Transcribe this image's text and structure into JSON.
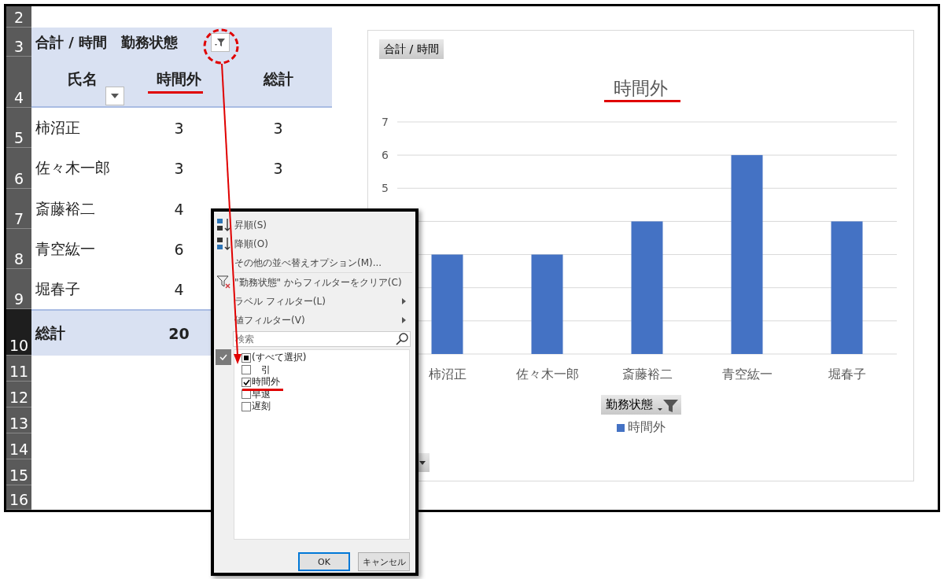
{
  "row_headers": [
    {
      "label": "2",
      "selected": false
    },
    {
      "label": "3",
      "selected": false
    },
    {
      "label": "4",
      "selected": false
    },
    {
      "label": "5",
      "selected": false
    },
    {
      "label": "6",
      "selected": false
    },
    {
      "label": "7",
      "selected": false
    },
    {
      "label": "8",
      "selected": false
    },
    {
      "label": "9",
      "selected": false
    },
    {
      "label": "10",
      "selected": true
    },
    {
      "label": "11",
      "selected": false
    },
    {
      "label": "12",
      "selected": false
    },
    {
      "label": "13",
      "selected": false
    },
    {
      "label": "14",
      "selected": false
    },
    {
      "label": "15",
      "selected": false
    },
    {
      "label": "16",
      "selected": false
    }
  ],
  "pivot": {
    "value_field": "合計 / 時間",
    "column_field": "勤務状態",
    "row_field": "氏名",
    "column": "時間外",
    "total_header": "総計",
    "rows": [
      {
        "name": "柿沼正",
        "value": "3",
        "total": "3"
      },
      {
        "name": "佐々木一郎",
        "value": "3",
        "total": "3"
      },
      {
        "name": "斎藤裕二",
        "value": "4"
      },
      {
        "name": "青空紘一",
        "value": "6"
      },
      {
        "name": "堀春子",
        "value": "4"
      }
    ],
    "grand_total": {
      "label": "総計",
      "value": "20"
    }
  },
  "chart": {
    "value_field_button": "合計 / 時間",
    "legend_field_button": "勤務状態",
    "chart_data": {
      "type": "bar",
      "title": "時間外",
      "categories": [
        "柿沼正",
        "佐々木一郎",
        "斎藤裕二",
        "青空紘一",
        "堀春子"
      ],
      "series": [
        {
          "name": "時間外",
          "color": "#4472c4",
          "values": [
            3,
            3,
            4,
            6,
            4
          ]
        }
      ],
      "ylim": [
        0,
        7
      ],
      "yticks": [
        5,
        6,
        7
      ]
    }
  },
  "filter_menu": {
    "items": [
      {
        "kind": "sort_asc",
        "label": "昇順(S)"
      },
      {
        "kind": "sort_desc",
        "label": "降順(O)"
      },
      {
        "kind": "plain",
        "label": "その他の並べ替えオプション(M)..."
      },
      {
        "kind": "clear_filter",
        "label": "\"勤務状態\" からフィルターをクリア(C)"
      },
      {
        "kind": "submenu",
        "label": "ラベル フィルター(L)"
      },
      {
        "kind": "submenu",
        "label": "値フィルター(V)"
      }
    ],
    "search": {
      "placeholder": "検索"
    },
    "select_all": {
      "label": "(すべて選択)",
      "mixed": true
    },
    "options": [
      {
        "label": "引",
        "checked": false
      },
      {
        "label": "時間外",
        "checked": true
      },
      {
        "label": "早退",
        "checked": false
      },
      {
        "label": "遅刻",
        "checked": false
      }
    ],
    "buttons": [
      {
        "label": "OK",
        "selected": true
      },
      {
        "label": "キャンセル",
        "selected": false
      }
    ]
  }
}
